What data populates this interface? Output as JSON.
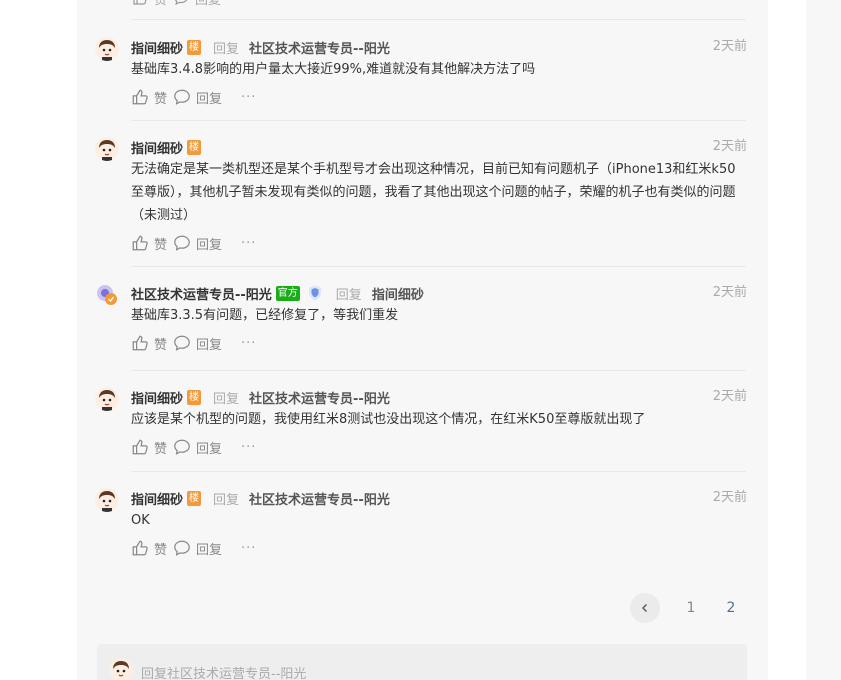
{
  "top_fragment": {
    "like_label": "赞",
    "reply_label": "回复"
  },
  "comments": [
    {
      "user": "指间细砂",
      "badge": "楼",
      "reply_word": "回复",
      "target": "社区技术运营专员--阳光",
      "time": "2天前",
      "text": "基础库3.4.8影响的用户量太大接近99%,难道就没有其他解决方法了吗",
      "like_label": "赞",
      "reply_label": "回复",
      "more": "···"
    },
    {
      "user": "指间细砂",
      "badge": "楼",
      "time": "2天前",
      "text": "无法确定是某一类机型还是某个手机型号才会出现这种情况，目前已知有问题机子（iPhone13和红米k50至尊版），其他机子暂未发现有类似的问题，我看了其他出现这个问题的帖子，荣耀的机子也有类似的问题（未测过）",
      "like_label": "赞",
      "reply_label": "回复",
      "more": "···"
    },
    {
      "user": "社区技术运营专员--阳光",
      "badge": "官方",
      "reply_word": "回复",
      "target": "指间细砂",
      "time": "2天前",
      "text": "基础库3.3.5有问题，已经修复了，等我们重发",
      "like_label": "赞",
      "reply_label": "回复",
      "more": "···"
    },
    {
      "user": "指间细砂",
      "badge": "楼",
      "reply_word": "回复",
      "target": "社区技术运营专员--阳光",
      "time": "2天前",
      "text": "应该是某个机型的问题，我使用红米8测试也没出现这个情况，在红米K50至尊版就出现了",
      "like_label": "赞",
      "reply_label": "回复",
      "more": "···"
    },
    {
      "user": "指间细砂",
      "badge": "楼",
      "reply_word": "回复",
      "target": "社区技术运营专员--阳光",
      "time": "2天前",
      "text": "OK",
      "like_label": "赞",
      "reply_label": "回复",
      "more": "···"
    }
  ],
  "pagination": {
    "pages": [
      "1",
      "2"
    ],
    "current": "2"
  },
  "reply_box": {
    "placeholder": "回复社区技术运营专员--阳光"
  },
  "colors": {
    "lou_badge": "#f29a3a",
    "official_badge": "#1aad19",
    "active_page": "#576b95"
  }
}
